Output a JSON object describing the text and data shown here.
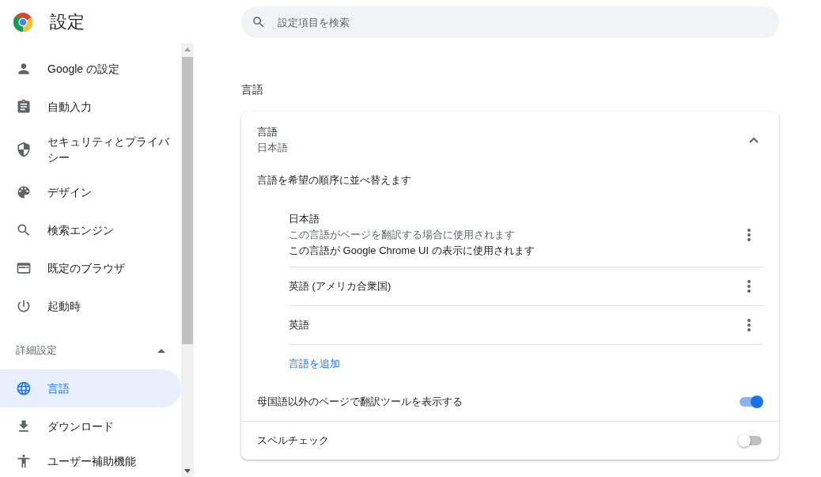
{
  "header": {
    "title": "設定"
  },
  "search": {
    "placeholder": "設定項目を検索"
  },
  "sidebar": {
    "items": [
      {
        "label": "Google の設定",
        "selected": false
      },
      {
        "label": "自動入力",
        "selected": false
      },
      {
        "label": "セキュリティとプライバシー",
        "selected": false
      },
      {
        "label": "デザイン",
        "selected": false
      },
      {
        "label": "検索エンジン",
        "selected": false
      },
      {
        "label": "既定のブラウザ",
        "selected": false
      },
      {
        "label": "起動時",
        "selected": false
      }
    ],
    "advanced": {
      "label": "詳細設定",
      "expanded": true,
      "items": [
        {
          "label": "言語",
          "selected": true
        },
        {
          "label": "ダウンロード",
          "selected": false
        },
        {
          "label": "ユーザー補助機能",
          "selected": false
        }
      ]
    }
  },
  "section_title": "言語",
  "card": {
    "title": "言語",
    "value": "日本語",
    "expanded": true,
    "description": "言語を希望の順序に並べ替えます",
    "languages": [
      {
        "name": "日本語",
        "notes": [
          {
            "text": "この言語がページを翻訳する場合に使用されます",
            "kind": "secondary"
          },
          {
            "text": "この言語が Google Chrome UI の表示に使用されます",
            "kind": "primary"
          }
        ]
      },
      {
        "name": "英語 (アメリカ合衆国)"
      },
      {
        "name": "英語"
      }
    ],
    "add_link": "言語を追加",
    "toggles": [
      {
        "label": "母国語以外のページで翻訳ツールを表示する",
        "on": true
      },
      {
        "label": "スペルチェック",
        "on": false
      }
    ]
  }
}
